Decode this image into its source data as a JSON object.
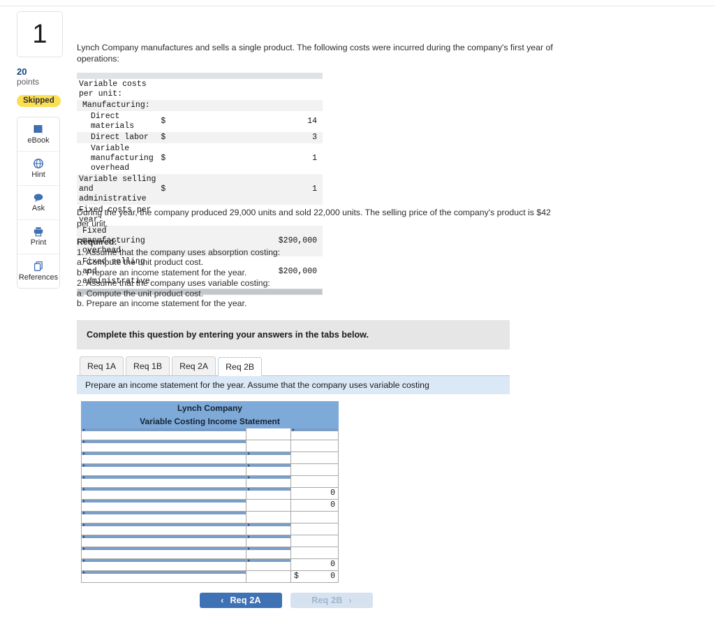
{
  "question": {
    "number": "1",
    "points_value": "20",
    "points_label": "points",
    "status_badge": "Skipped"
  },
  "tools": [
    {
      "label": "eBook",
      "icon": "book-icon"
    },
    {
      "label": "Hint",
      "icon": "globe-hint-icon"
    },
    {
      "label": "Ask",
      "icon": "speech-bubble-icon"
    },
    {
      "label": "Print",
      "icon": "printer-icon"
    },
    {
      "label": "References",
      "icon": "copy-pages-icon"
    }
  ],
  "intro_text": "Lynch Company manufactures and sells a single product. The following costs were incurred during the company's first year of operations:",
  "cost_table": {
    "rows": [
      {
        "label": "Variable costs per unit:",
        "indent": 0,
        "currency": "",
        "value": ""
      },
      {
        "label": "Manufacturing:",
        "indent": 1,
        "currency": "",
        "value": ""
      },
      {
        "label": "Direct materials",
        "indent": 2,
        "currency": "$",
        "value": "14"
      },
      {
        "label": "Direct labor",
        "indent": 2,
        "currency": "$",
        "value": "3"
      },
      {
        "label": "Variable manufacturing overhead",
        "indent": 2,
        "currency": "$",
        "value": "1"
      },
      {
        "label": "Variable selling and administrative",
        "indent": 0,
        "currency": "$",
        "value": "1"
      },
      {
        "label": "Fixed costs per year:",
        "indent": 0,
        "currency": "",
        "value": ""
      },
      {
        "label": "Fixed manufacturing overhead",
        "indent": 1,
        "currency": "",
        "value": "$290,000"
      },
      {
        "label": "Fixed selling and administrative",
        "indent": 1,
        "currency": "",
        "value": "$200,000"
      }
    ]
  },
  "during_text": "During the year, the company produced 29,000 units and sold 22,000 units. The selling price of the company's product is $42 per unit.",
  "required": {
    "heading": "Required:",
    "lines": [
      "1. Assume that the company uses absorption costing:",
      "a. Compute the unit product cost.",
      "b. Prepare an income statement for the year.",
      "2. Assume that the company uses variable costing:",
      "a. Compute the unit product cost.",
      "b. Prepare an income statement for the year."
    ]
  },
  "answer_panel": {
    "complete_bar": "Complete this question by entering your answers in the tabs below.",
    "tabs": [
      {
        "label": "Req 1A",
        "active": false
      },
      {
        "label": "Req 1B",
        "active": false
      },
      {
        "label": "Req 2A",
        "active": false
      },
      {
        "label": "Req 2B",
        "active": true
      }
    ],
    "tab_instruction": "Prepare an income statement for the year. Assume that the company uses variable costing"
  },
  "income_statement": {
    "title_line_1": "Lynch Company",
    "title_line_2": "Variable Costing Income Statement",
    "rows": [
      {
        "label": "",
        "mid": "",
        "val": "",
        "label_dd": true,
        "mid_dd": false,
        "val_dd": true,
        "topline": false,
        "dblbottom": false,
        "dollar": ""
      },
      {
        "label": "",
        "mid": "",
        "val": "",
        "label_dd": true,
        "mid_dd": false,
        "val_dd": false,
        "topline": false,
        "dblbottom": false,
        "dollar": ""
      },
      {
        "label": "",
        "mid": "",
        "val": "",
        "label_dd": true,
        "mid_dd": true,
        "val_dd": false,
        "topline": false,
        "dblbottom": false,
        "dollar": ""
      },
      {
        "label": "",
        "mid": "",
        "val": "",
        "label_dd": true,
        "mid_dd": true,
        "val_dd": false,
        "topline": false,
        "dblbottom": false,
        "dollar": ""
      },
      {
        "label": "",
        "mid": "",
        "val": "",
        "label_dd": true,
        "mid_dd": true,
        "val_dd": false,
        "topline": false,
        "dblbottom": false,
        "dollar": ""
      },
      {
        "label": "",
        "mid": "",
        "val": "0",
        "label_dd": true,
        "mid_dd": true,
        "val_dd": false,
        "topline": false,
        "dblbottom": false,
        "dollar": ""
      },
      {
        "label": "",
        "mid": "",
        "val": "0",
        "label_dd": true,
        "mid_dd": false,
        "val_dd": false,
        "topline": true,
        "dblbottom": false,
        "dollar": ""
      },
      {
        "label": "",
        "mid": "",
        "val": "",
        "label_dd": true,
        "mid_dd": false,
        "val_dd": false,
        "topline": false,
        "dblbottom": false,
        "dollar": ""
      },
      {
        "label": "",
        "mid": "",
        "val": "",
        "label_dd": true,
        "mid_dd": true,
        "val_dd": false,
        "topline": false,
        "dblbottom": false,
        "dollar": ""
      },
      {
        "label": "",
        "mid": "",
        "val": "",
        "label_dd": true,
        "mid_dd": true,
        "val_dd": false,
        "topline": false,
        "dblbottom": false,
        "dollar": ""
      },
      {
        "label": "",
        "mid": "",
        "val": "",
        "label_dd": true,
        "mid_dd": true,
        "val_dd": false,
        "topline": false,
        "dblbottom": false,
        "dollar": ""
      },
      {
        "label": "",
        "mid": "",
        "val": "0",
        "label_dd": true,
        "mid_dd": true,
        "val_dd": false,
        "topline": false,
        "dblbottom": false,
        "dollar": ""
      },
      {
        "label": "",
        "mid": "",
        "val": "0",
        "label_dd": true,
        "mid_dd": false,
        "val_dd": false,
        "topline": true,
        "dblbottom": true,
        "dollar": "$"
      }
    ]
  },
  "nav": {
    "prev_label": "Req 2A",
    "next_label": "Req 2B",
    "prev_chevron": "‹",
    "next_chevron": "›"
  },
  "colors": {
    "header_blue": "#7eaada",
    "instruction_blue": "#dbe9f6",
    "badge_yellow": "#fbdf52",
    "primary_button": "#3f72b5",
    "disabled_button": "#d6e2ef",
    "points_blue": "#11447a"
  }
}
